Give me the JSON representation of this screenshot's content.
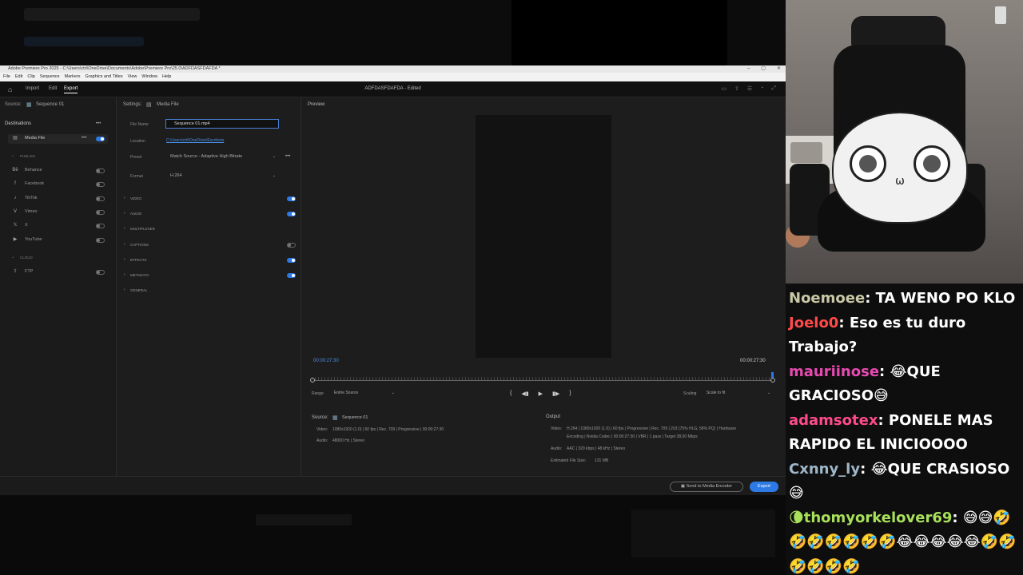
{
  "premiere": {
    "window_title": "Adobe Premiere Pro 2025 - C:\\Users\\ctrl\\OneDrive\\Documents\\Adobe\\Premiere Pro\\25.0\\ADFDASFDAFDA *",
    "window_controls": [
      "–",
      "▢",
      "✕"
    ],
    "menu": [
      "File",
      "Edit",
      "Clip",
      "Sequence",
      "Markers",
      "Graphics and Titles",
      "View",
      "Window",
      "Help"
    ],
    "workspace_tabs": [
      "Import",
      "Edit",
      "Export"
    ],
    "active_tab": "Export",
    "document_title": "ADFDASFDAFDA - Edited",
    "source_label": "Source:",
    "source_name": "Sequence 01",
    "destinations_label": "Destinations",
    "more_dots": "•••",
    "media_file_label": "Media File",
    "publish_label": "PUBLISH",
    "cloud_label": "CLOUD",
    "publish_items": [
      {
        "name": "Behance",
        "icon": "behance-icon",
        "glyph": "Bē",
        "on": false
      },
      {
        "name": "Facebook",
        "icon": "facebook-icon",
        "glyph": "f",
        "on": false
      },
      {
        "name": "TikTok",
        "icon": "tiktok-icon",
        "glyph": "♪",
        "on": false
      },
      {
        "name": "Vimeo",
        "icon": "vimeo-icon",
        "glyph": "V",
        "on": false
      },
      {
        "name": "X",
        "icon": "x-icon",
        "glyph": "𝕏",
        "on": false
      },
      {
        "name": "YouTube",
        "icon": "youtube-icon",
        "glyph": "▶",
        "on": false
      }
    ],
    "cloud_items": [
      {
        "name": "FTP",
        "icon": "ftp-icon",
        "glyph": "⇪",
        "on": false
      }
    ],
    "settings_label": "Settings:",
    "settings_target": "Media File",
    "file_name_label": "File Name",
    "file_name_value": "Sequence 01.mp4",
    "location_label": "Location",
    "location_value": "C:\\Users\\ctrl\\OneDrive\\Escritorio",
    "preset_label": "Preset",
    "preset_value": "Match Source - Adaptive High Bitrate",
    "format_label": "Format",
    "format_value": "H.264",
    "sections": [
      {
        "name": "VIDEO",
        "on": true
      },
      {
        "name": "AUDIO",
        "on": true
      },
      {
        "name": "MULTIPLEXER",
        "toggle": false
      },
      {
        "name": "CAPTIONS",
        "on": false
      },
      {
        "name": "EFFECTS",
        "on": true
      },
      {
        "name": "METADATA",
        "on": true
      },
      {
        "name": "GENERAL",
        "toggle": false
      }
    ],
    "preview_label": "Preview",
    "timecode_left": "00:00:27:30",
    "timecode_right": "00:00:27:30",
    "range_label": "Range",
    "range_value": "Entire Source",
    "scaling_label": "Scaling",
    "scaling_value": "Scale to fit",
    "transport": [
      "{",
      "◀▮",
      "▶",
      "▮▶",
      "}"
    ],
    "source_info": {
      "title": "Source:",
      "name": "Sequence 01",
      "video_label": "Video:",
      "video_value": "1080x1920 (1.0) | 60 fps | Rec. 709 | Progressive | 00:00:27:30",
      "audio_label": "Audio:",
      "audio_value": "48000 Hz | Stereo"
    },
    "output_info": {
      "title": "Output",
      "video_label": "Video:",
      "video_value_1": "H.264 | 1080x1920 (1.0) | 60 fps | Progressive | Rec. 709 | 203 (75% HLG, 58% PQ) | Hardware",
      "video_value_2": "Encoding | Nvidia Codec | 00:00:27:30 | VBR | 1 pass | Target 38,00 Mbps",
      "audio_label": "Audio:",
      "audio_value": "AAC | 320 kbps | 48 kHz | Stereo",
      "size_label": "Estimated File Size:",
      "size_value": "131 MB"
    },
    "send_to_encoder": "Send to Media Encoder",
    "export_button": "Export"
  },
  "chat": [
    {
      "user": "Noemoee",
      "color": "#c9c9a8",
      "message": "TA WENO PO KLO"
    },
    {
      "user": "Joelo0",
      "color": "#ff4a4a",
      "message": "Eso es tu duro Trabajo?"
    },
    {
      "user": "mauriinose",
      "color": "#e64ab0",
      "message": "😂QUE GRACIOSO😅"
    },
    {
      "user": "adamsotex",
      "color": "#ff4a8a",
      "message": "PONELE MAS RAPIDO EL INICIOOOO"
    },
    {
      "user": "Cxnny_ly",
      "color": "#9fb8c9",
      "message": "😂QUE CRASIOSO 😅"
    },
    {
      "user": "🌘thomyorkelover69",
      "color": "#a8e05a",
      "message": "😅😅🤣🤣🤣🤣🤣🤣🤣😂😂😂😂😂🤣🤣🤣🤣🤣🤣"
    }
  ]
}
